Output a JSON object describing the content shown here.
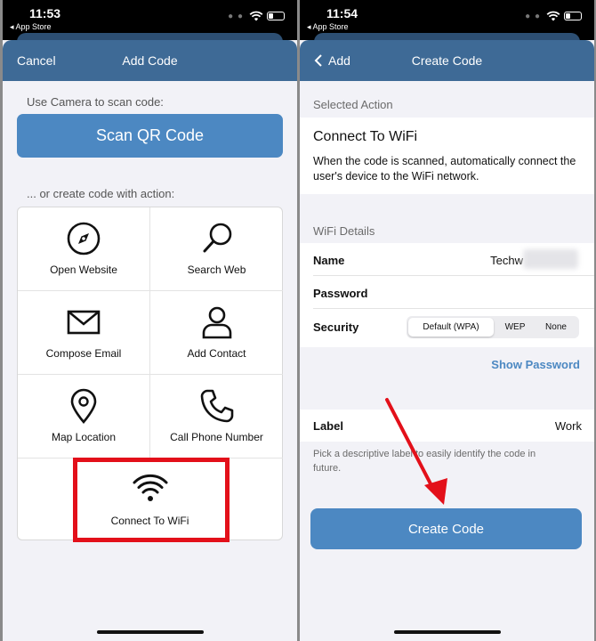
{
  "status_left": {
    "time": "11:53",
    "back_app": "◂ App Store"
  },
  "status_right": {
    "time": "11:54",
    "back_app": "◂ App Store"
  },
  "left": {
    "nav": {
      "cancel": "Cancel",
      "title": "Add Code"
    },
    "camera_label": "Use Camera to scan code:",
    "scan_button": "Scan QR Code",
    "create_label": "... or create code with action:",
    "actions": [
      {
        "label": "Open Website",
        "icon": "compass-icon"
      },
      {
        "label": "Search Web",
        "icon": "magnifier-icon"
      },
      {
        "label": "Compose Email",
        "icon": "envelope-icon"
      },
      {
        "label": "Add Contact",
        "icon": "person-icon"
      },
      {
        "label": "Map Location",
        "icon": "map-pin-icon"
      },
      {
        "label": "Call Phone Number",
        "icon": "phone-icon"
      },
      {
        "label": "Connect To WiFi",
        "icon": "wifi-icon"
      }
    ],
    "highlight_color": "#e3101a"
  },
  "right": {
    "nav": {
      "back": "Add",
      "title": "Create Code"
    },
    "selected_action_header": "Selected Action",
    "action_title": "Connect To WiFi",
    "action_desc": "When the code is scanned, automatically connect the user's device to the WiFi network.",
    "wifi_header": "WiFi Details",
    "name_label": "Name",
    "name_value": "Techw",
    "password_label": "Password",
    "security_label": "Security",
    "security_options": [
      "Default (WPA)",
      "WEP",
      "None"
    ],
    "security_selected": "Default (WPA)",
    "show_password": "Show Password",
    "label_label": "Label",
    "label_value": "Work",
    "label_hint": "Pick a descriptive label to easily identify the code in future.",
    "create_button": "Create Code",
    "accent_color": "#4c88c2",
    "arrow_color": "#e3101a"
  }
}
